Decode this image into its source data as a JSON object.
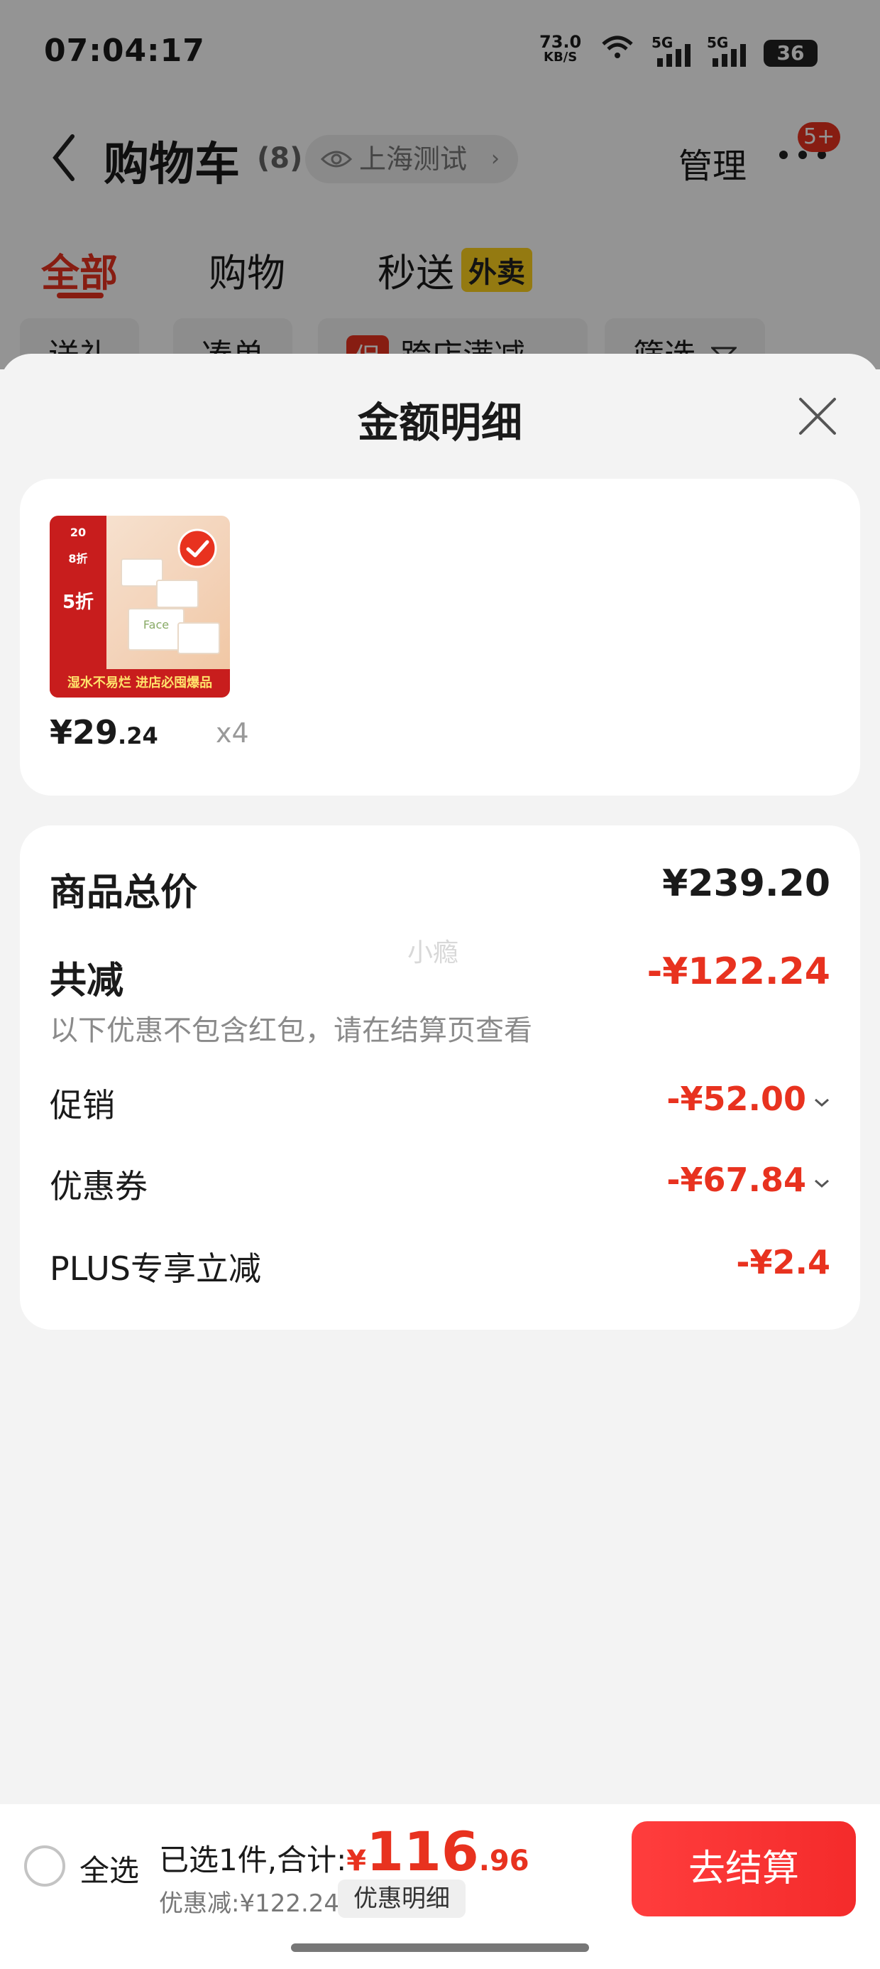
{
  "status_bar": {
    "time": "07:04:17",
    "net_speed": "73.0",
    "net_unit": "KB/S",
    "signal1": "5G",
    "signal2": "5G",
    "battery": "36"
  },
  "header": {
    "title": "购物车",
    "count": "(8)",
    "location": "上海测试",
    "manage": "管理",
    "badge": "5+"
  },
  "tabs": [
    {
      "label": "全部",
      "active": true
    },
    {
      "label": "购物",
      "active": false
    },
    {
      "label": "秒送",
      "active": false,
      "tag": "外卖"
    }
  ],
  "filters": {
    "gift": "送礼",
    "combine": "凑单",
    "promo_tag": "促",
    "cross_store": "跨店满减",
    "filter": "筛选"
  },
  "sheet": {
    "title": "金额明细",
    "product": {
      "price_int": "¥29",
      "price_dec": ".24",
      "qty": "x4",
      "thumb_text": {
        "brand": "Face",
        "banner": "湿水不易烂  进店必囤爆品",
        "tag1": "20",
        "tag2": "8折",
        "tag3": "5折"
      }
    },
    "summary": {
      "total_label": "商品总价",
      "total_value": "¥239.20",
      "reduced_label": "共减",
      "reduced_value": "-¥122.24",
      "note": "以下优惠不包含红包，请在结算页查看",
      "watermark": "小瘾",
      "items": [
        {
          "label": "促销",
          "value": "-¥52.00",
          "expandable": true
        },
        {
          "label": "优惠券",
          "value": "-¥67.84",
          "expandable": true
        },
        {
          "label": "PLUS专享立减",
          "value": "-¥2.4",
          "expandable": false
        }
      ]
    }
  },
  "bottom_bar": {
    "select_all": "全选",
    "selected_text": "已选1件,合计:",
    "yen": "¥",
    "amount_int": "116",
    "amount_dec": ".96",
    "discount_text": "优惠减:¥122.24",
    "detail_button": "优惠明细",
    "checkout": "去结算"
  },
  "colors": {
    "accent": "#e8321f",
    "checkout": "#f42b2b"
  }
}
